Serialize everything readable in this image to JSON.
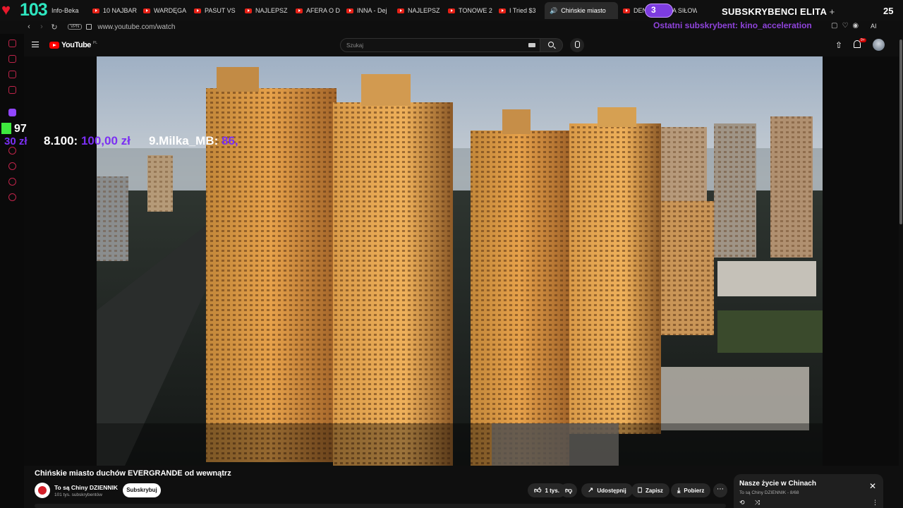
{
  "overlay": {
    "hearts": "103",
    "sub_goal_count": "3",
    "sub_title": "SUBSKRYBENCI ELITA",
    "sub_plus": "+",
    "sub_total": "25",
    "last_subscriber": "Ostatni subskrybent: kino_acceleration",
    "donations": {
      "k_count": "97",
      "left_amount": "30 zł",
      "entry1_name": "8.100:",
      "entry1_amount": "100,00 zł",
      "entry2_name": "9.Milka_MB:",
      "entry2_amount": "86,"
    }
  },
  "browser": {
    "tabs": [
      {
        "label": "Info-Beka"
      },
      {
        "label": "10 NAJBAR"
      },
      {
        "label": "WARDĘGA"
      },
      {
        "label": "PASUT VS"
      },
      {
        "label": "NAJLEPSZ"
      },
      {
        "label": "AFERA O D"
      },
      {
        "label": "INNA - Dej"
      },
      {
        "label": "NAJLEPSZ"
      },
      {
        "label": "TONOWE 2"
      },
      {
        "label": "I Tried $3"
      },
      {
        "label": "Chińskie miasto"
      },
      {
        "label": "DEN"
      },
      {
        "label": "TA SIŁOW"
      }
    ],
    "vpn": "VPN",
    "url": "www.youtube.com/watch",
    "ai": "AI"
  },
  "youtube": {
    "logo": "YouTube",
    "country": "PL",
    "search_placeholder": "Szukaj",
    "notifications": "9+",
    "video_title": "Chińskie miasto duchów EVERGRANDE od wewnątrz",
    "channel_name": "To są Chiny DZIENNIK",
    "channel_subs": "101 tys. subskrybentów",
    "subscribe_label": "Subskrybuj",
    "likes": "1 tys.",
    "share_label": "Udostępnij",
    "save_label": "Zapisz",
    "download_label": "Pobierz"
  },
  "playlist": {
    "title": "Nasze życie w Chinach",
    "subtitle": "To są Chiny DZIENNIK - 8/68"
  }
}
